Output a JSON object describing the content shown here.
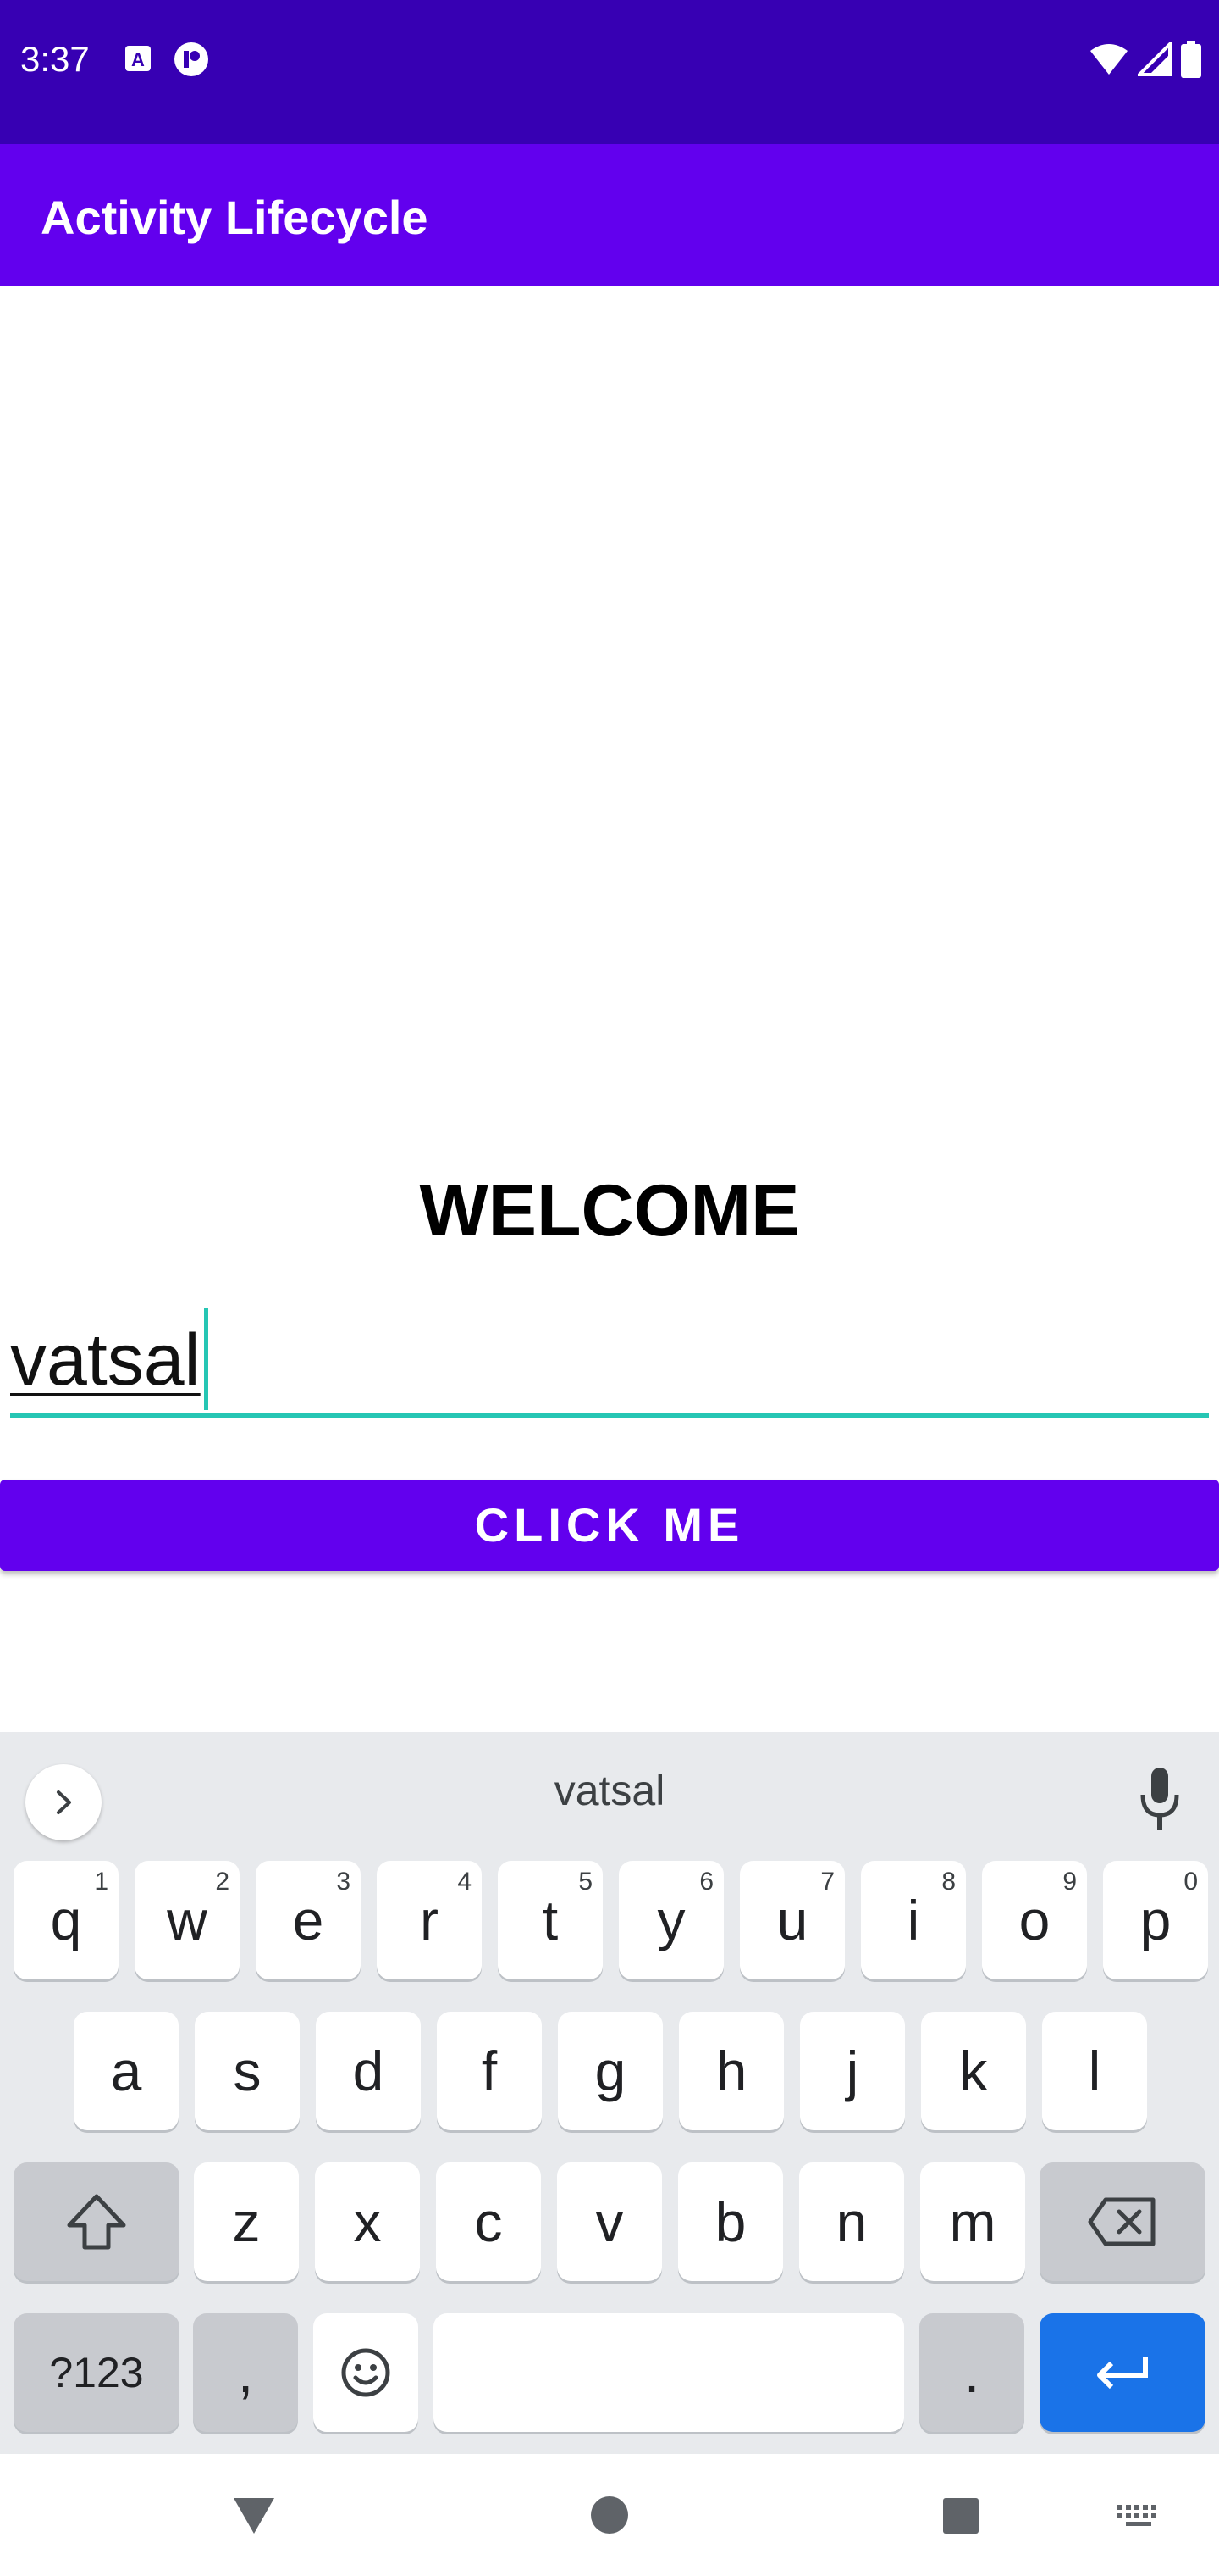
{
  "status_bar": {
    "time": "3:37",
    "left_icons": [
      "a-notification-icon",
      "app-notification-icon"
    ],
    "right_icons": [
      "wifi-icon",
      "signal-icon",
      "battery-icon"
    ]
  },
  "app_bar": {
    "title": "Activity Lifecycle"
  },
  "main": {
    "welcome": "WELCOME",
    "input_value": "vatsal",
    "button_label": "CLICK ME"
  },
  "keyboard": {
    "suggestion": "vatsal",
    "row1": [
      {
        "label": "q",
        "hint": "1"
      },
      {
        "label": "w",
        "hint": "2"
      },
      {
        "label": "e",
        "hint": "3"
      },
      {
        "label": "r",
        "hint": "4"
      },
      {
        "label": "t",
        "hint": "5"
      },
      {
        "label": "y",
        "hint": "6"
      },
      {
        "label": "u",
        "hint": "7"
      },
      {
        "label": "i",
        "hint": "8"
      },
      {
        "label": "o",
        "hint": "9"
      },
      {
        "label": "p",
        "hint": "0"
      }
    ],
    "row2": [
      "a",
      "s",
      "d",
      "f",
      "g",
      "h",
      "j",
      "k",
      "l"
    ],
    "row3": [
      "z",
      "x",
      "c",
      "v",
      "b",
      "n",
      "m"
    ],
    "symbols_label": "?123",
    "comma_label": ",",
    "period_label": "."
  },
  "colors": {
    "status_bar": "#3700b3",
    "primary": "#6200ee",
    "accent": "#26c6b4",
    "enter_key": "#1a73e8"
  }
}
